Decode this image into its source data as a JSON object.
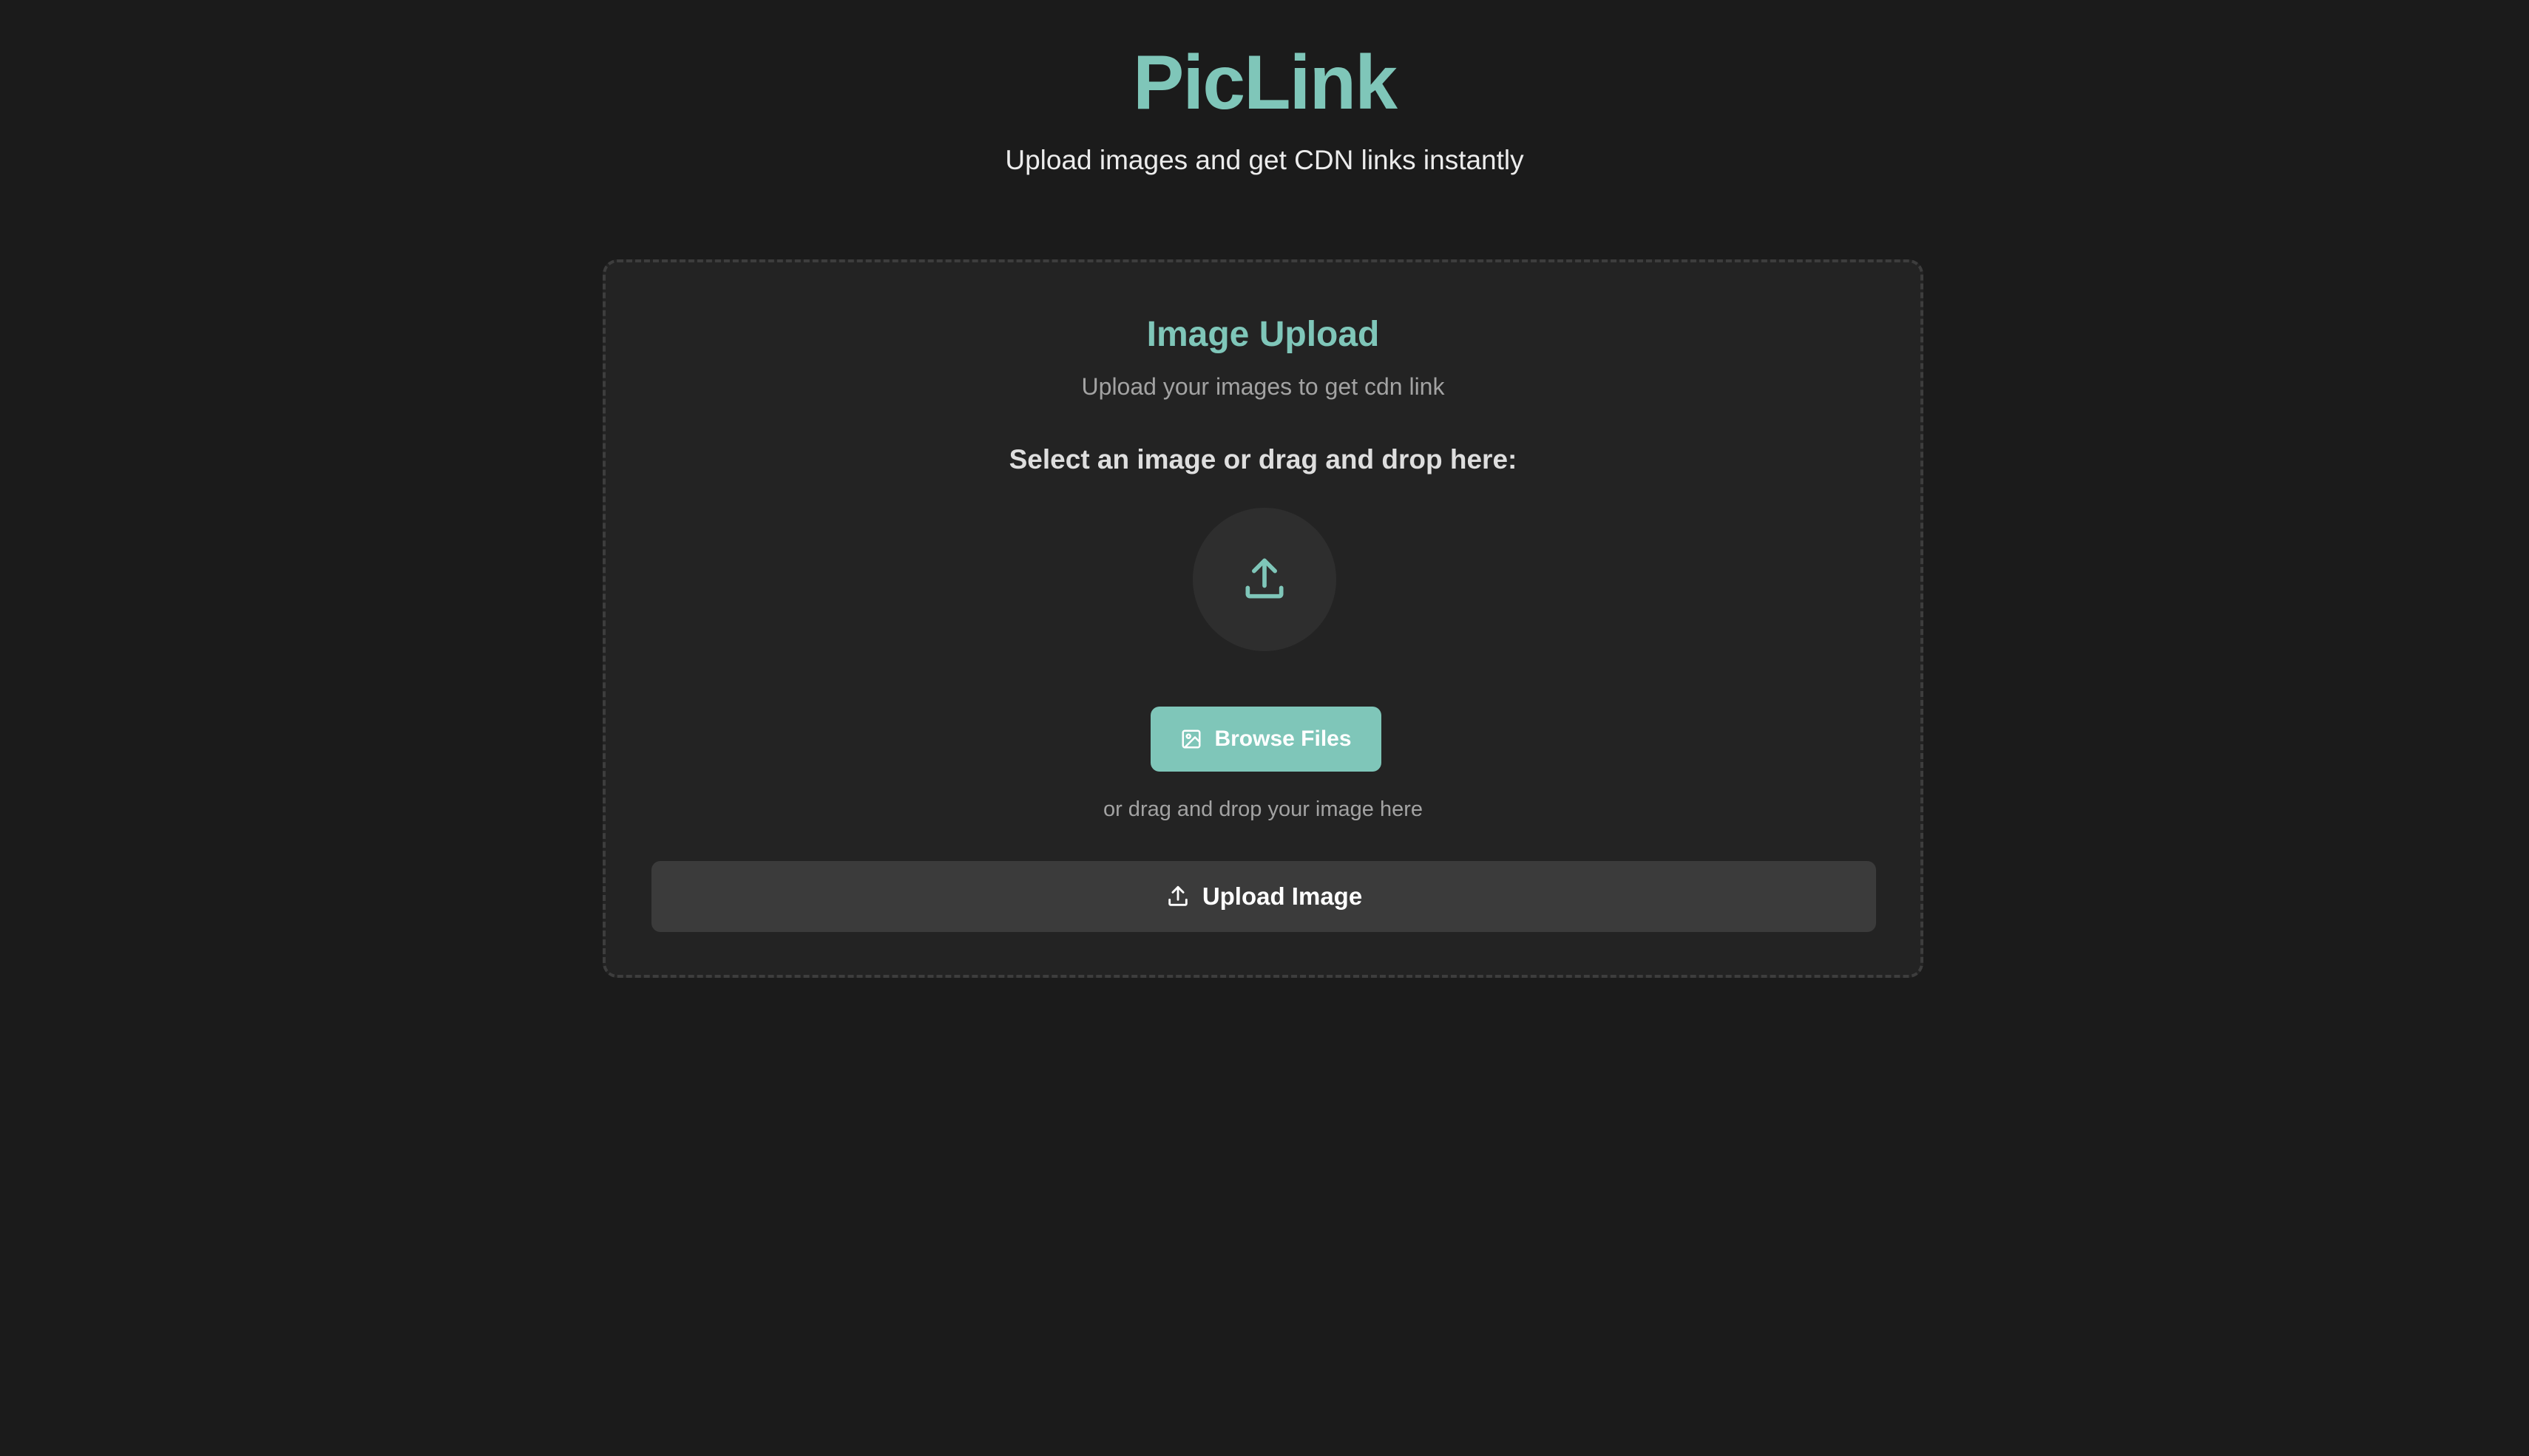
{
  "app": {
    "title": "PicLink",
    "tagline": "Upload images and get CDN links instantly"
  },
  "upload_card": {
    "title": "Image Upload",
    "subtitle": "Upload your images to get cdn link",
    "select_label": "Select an image or drag and drop here:",
    "drop_icon": "upload-tray-icon",
    "browse_button": {
      "label": "Browse Files",
      "icon": "image-icon"
    },
    "drag_hint": "or drag and drop your image here",
    "upload_button": {
      "label": "Upload Image",
      "icon": "upload-icon"
    }
  },
  "colors": {
    "background": "#1b1b1b",
    "card_background": "#232323",
    "accent": "#7fc6b9",
    "upload_button_background": "#3b3b3b"
  }
}
